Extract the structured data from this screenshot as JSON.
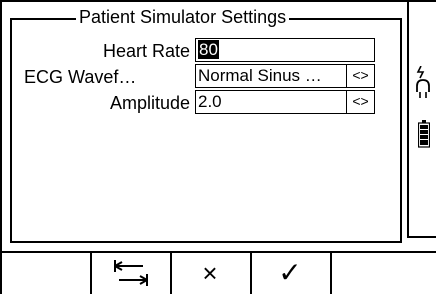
{
  "dialog": {
    "title": "Patient Simulator Settings"
  },
  "fields": [
    {
      "label": "Heart Rate",
      "value": "80"
    },
    {
      "label": "ECG Wavef…",
      "value": "Normal Sinus …",
      "arrow": "<>"
    },
    {
      "label": "Amplitude",
      "value": "2.0",
      "arrow": "<>"
    }
  ],
  "status": {
    "icons": [
      "plug-icon",
      "battery-icon"
    ]
  },
  "softkeys": [
    {
      "name": "tab-arrows-icon"
    },
    {
      "name": "cancel-icon",
      "glyph": "×"
    },
    {
      "name": "confirm-icon",
      "glyph": "✓"
    }
  ]
}
